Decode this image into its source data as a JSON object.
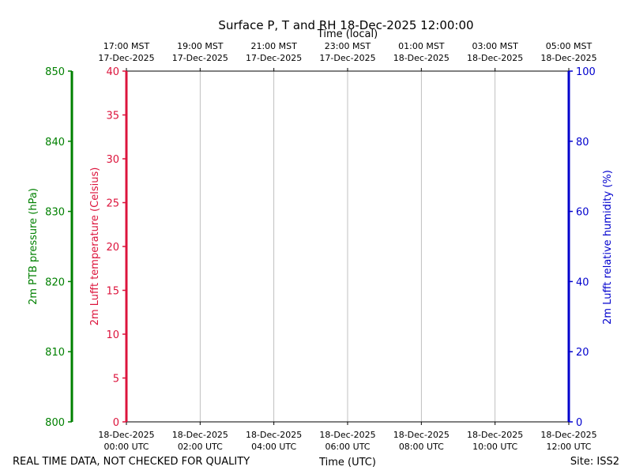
{
  "chart_data": {
    "type": "line",
    "title": "Surface P, T and RH 18-Dec-2025 12:00:00",
    "top_axis_label": "Time (local)",
    "xlabel": "Time (UTC)",
    "x_ticks_utc": [
      {
        "line1": "18-Dec-2025",
        "line2": "00:00 UTC"
      },
      {
        "line1": "18-Dec-2025",
        "line2": "02:00 UTC"
      },
      {
        "line1": "18-Dec-2025",
        "line2": "04:00 UTC"
      },
      {
        "line1": "18-Dec-2025",
        "line2": "06:00 UTC"
      },
      {
        "line1": "18-Dec-2025",
        "line2": "08:00 UTC"
      },
      {
        "line1": "18-Dec-2025",
        "line2": "10:00 UTC"
      },
      {
        "line1": "18-Dec-2025",
        "line2": "12:00 UTC"
      }
    ],
    "x_ticks_local": [
      {
        "line1": "17:00 MST",
        "line2": "17-Dec-2025"
      },
      {
        "line1": "19:00 MST",
        "line2": "17-Dec-2025"
      },
      {
        "line1": "21:00 MST",
        "line2": "17-Dec-2025"
      },
      {
        "line1": "23:00 MST",
        "line2": "17-Dec-2025"
      },
      {
        "line1": "01:00 MST",
        "line2": "18-Dec-2025"
      },
      {
        "line1": "03:00 MST",
        "line2": "18-Dec-2025"
      },
      {
        "line1": "05:00 MST",
        "line2": "18-Dec-2025"
      }
    ],
    "axes": {
      "pressure": {
        "label": "2m PTB pressure (hPa)",
        "ylim": [
          800,
          850
        ],
        "ticks": [
          800,
          810,
          820,
          830,
          840,
          850
        ],
        "color": "#008000"
      },
      "temperature": {
        "label": "2m Lufft temperature (Celsius)",
        "ylim": [
          0,
          40
        ],
        "ticks": [
          0,
          5,
          10,
          15,
          20,
          25,
          30,
          35,
          40
        ],
        "color": "#dc143c"
      },
      "humidity": {
        "label": "2m Lufft relative humidity (%)",
        "ylim": [
          0,
          100
        ],
        "ticks": [
          0,
          20,
          40,
          60,
          80,
          100
        ],
        "color": "#0000cd"
      }
    },
    "grid": "vertical",
    "series": []
  },
  "footer": {
    "disclaimer": "REAL TIME DATA, NOT CHECKED FOR QUALITY",
    "site": "Site: ISS2"
  }
}
